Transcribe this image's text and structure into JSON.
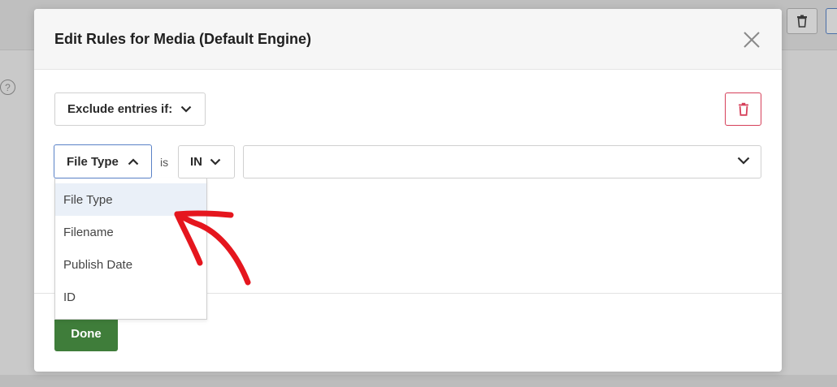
{
  "modal": {
    "title": "Edit Rules for Media (Default Engine)"
  },
  "rule": {
    "mode_label": "Exclude entries if:",
    "field_selected": "File Type",
    "is_text": "is",
    "operator_selected": "IN",
    "value_selected": ""
  },
  "dropdown": {
    "options": [
      "File Type",
      "Filename",
      "Publish Date",
      "ID"
    ],
    "active_index": 0
  },
  "footer": {
    "done_label": "Done"
  },
  "colors": {
    "accent_blue": "#5a82c7",
    "danger_red": "#d6405a",
    "done_green": "#3f7d3a",
    "annotation_red": "#e5161e"
  }
}
